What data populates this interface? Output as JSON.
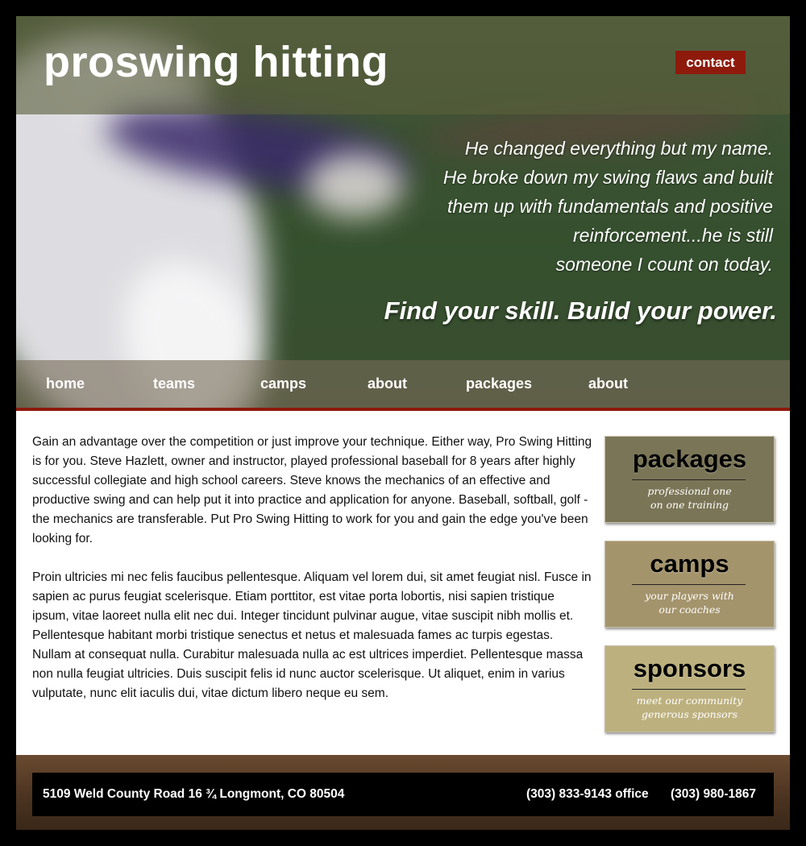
{
  "site": {
    "title": "proswing hitting",
    "contact_label": "contact"
  },
  "hero": {
    "quote_lines": [
      "He changed everything but my name.",
      "He broke down my swing flaws and built",
      "them up with fundamentals and positive",
      "reinforcement...he is still",
      "someone I count on today."
    ],
    "tagline": "Find your skill.  Build your power."
  },
  "nav": {
    "items": [
      "home",
      "teams",
      "camps",
      "about",
      "packages",
      "about"
    ]
  },
  "content": {
    "paragraphs": [
      "Gain an advantage over the competition or just improve your technique. Either way, Pro Swing Hitting is for you. Steve Hazlett, owner and instructor, played professional baseball for 8 years after highly successful collegiate and high school careers. Steve knows the mechanics of an effective and productive swing and can help put it into practice and application for anyone. Baseball, softball, golf - the mechanics are transferable. Put Pro Swing Hitting to work for you and gain the edge you've been looking for.",
      "Proin ultricies mi nec felis faucibus pellentesque. Aliquam vel lorem dui, sit amet feugiat nisl. Fusce in sapien ac purus feugiat scelerisque. Etiam porttitor, est vitae porta lobortis, nisi sapien tristique ipsum, vitae laoreet nulla elit nec dui. Integer tincidunt pulvinar augue, vitae suscipit nibh mollis et. Pellentesque habitant morbi tristique senectus et netus et malesuada fames ac turpis egestas. Nullam at consequat nulla. Curabitur malesuada nulla ac est ultrices imperdiet. Pellentesque massa non nulla feugiat ultricies. Duis suscipit felis id nunc auctor scelerisque. Ut aliquet, enim in varius vulputate, nunc elit iaculis dui, vitae dictum libero neque eu sem."
    ]
  },
  "sidebar": {
    "cards": [
      {
        "title": "packages",
        "subtitle": "professional one\non one training",
        "color": "#7a7556"
      },
      {
        "title": "camps",
        "subtitle": "your players with\nour coaches",
        "color": "#a4946c"
      },
      {
        "title": "sponsors",
        "subtitle": "meet our community\ngenerous sponsors",
        "color": "#bcb07e"
      }
    ]
  },
  "footer": {
    "address": "5109 Weld County Road 16 ¾ Longmont, CO 80504",
    "phone_office": "(303) 833-9143 office",
    "phone_other": "(303) 980-1867"
  },
  "colors": {
    "accent_red": "#8e1a0c",
    "background": "#000000"
  }
}
